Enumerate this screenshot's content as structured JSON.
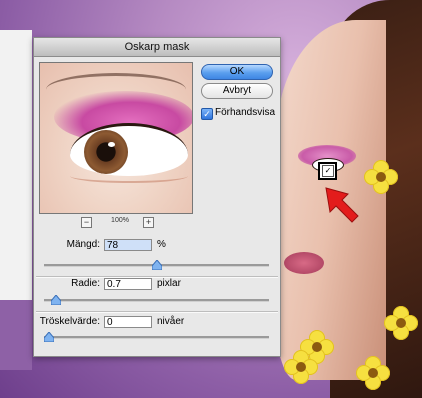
{
  "dialog": {
    "title": "Oskarp mask",
    "ok_label": "OK",
    "cancel_label": "Avbryt",
    "preview_label": "Förhandsvisa",
    "preview_checked": true,
    "zoom": {
      "minus": "−",
      "plus": "+",
      "level": "100%"
    },
    "amount": {
      "label": "Mängd:",
      "value": "78",
      "unit": "%",
      "slider_fraction": 0.48
    },
    "radius": {
      "label": "Radie:",
      "value": "0.7",
      "unit": "pixlar",
      "slider_fraction": 0.03
    },
    "threshold": {
      "label": "Tröskelvärde:",
      "value": "0",
      "unit": "nivåer",
      "slider_fraction": 0.0
    }
  },
  "colors": {
    "ok_button": "#5b9fee",
    "slider_thumb": "#7fb3f0",
    "arrow": "#e31c1c"
  },
  "icons": [
    "zoom-out-icon",
    "zoom-in-icon",
    "checkbox-check-icon",
    "red-arrow-icon",
    "zoom-target-icon"
  ]
}
